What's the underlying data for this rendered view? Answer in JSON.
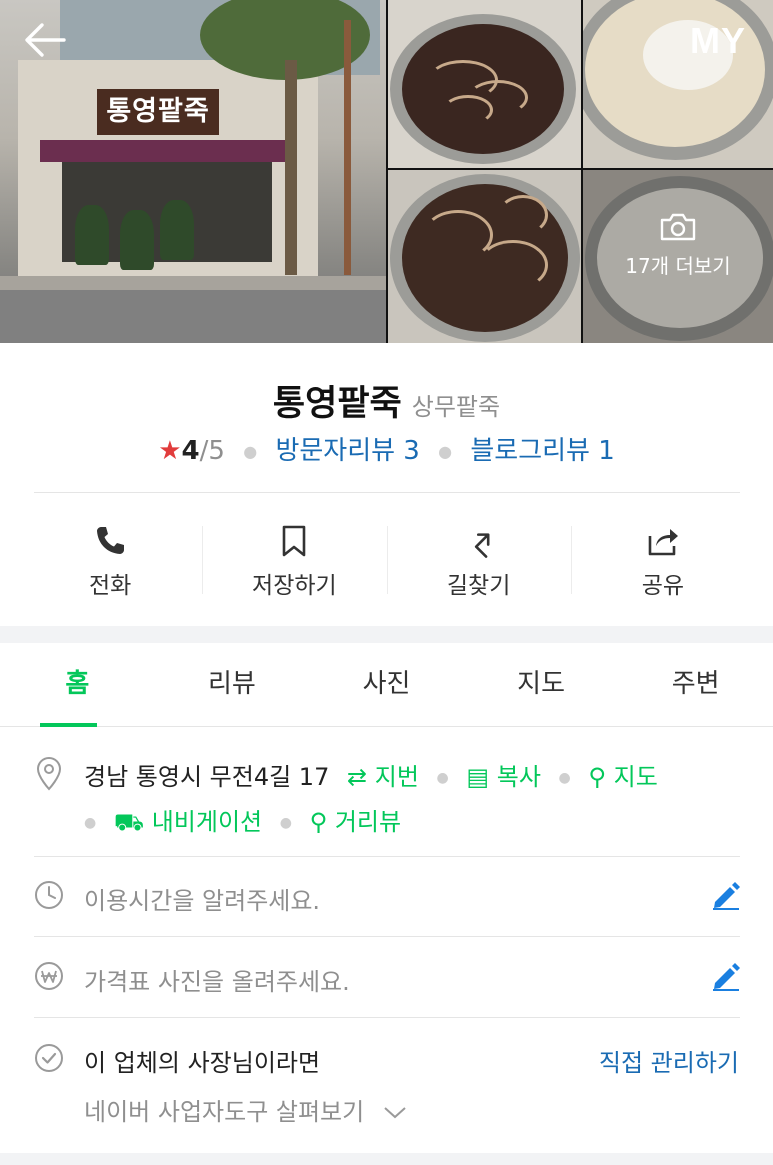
{
  "gallery": {
    "main_photo": {
      "signboard_text": "통영팥죽"
    },
    "more_photos_label": "17개 더보기",
    "my_label": "MY"
  },
  "place": {
    "name": "통영팥죽",
    "category": "상무팥죽",
    "rating": "4",
    "rating_max": "/5",
    "visitor_reviews": "방문자리뷰 3",
    "blog_reviews": "블로그리뷰 1"
  },
  "actions": [
    {
      "label": "전화",
      "icon": "phone-icon"
    },
    {
      "label": "저장하기",
      "icon": "bookmark-icon"
    },
    {
      "label": "길찾기",
      "icon": "directions-icon"
    },
    {
      "label": "공유",
      "icon": "share-icon"
    }
  ],
  "tabs": [
    {
      "label": "홈",
      "active": true
    },
    {
      "label": "리뷰",
      "active": false
    },
    {
      "label": "사진",
      "active": false
    },
    {
      "label": "지도",
      "active": false
    },
    {
      "label": "주변",
      "active": false
    }
  ],
  "info": {
    "address": "경남 통영시 무전4길 17",
    "address_links": [
      "지번",
      "복사",
      "지도"
    ],
    "address_links_2": [
      "내비게이션",
      "거리뷰"
    ],
    "hours_placeholder": "이용시간을 알려주세요.",
    "price_placeholder": "가격표 사진을 올려주세요.",
    "owner_text": "이 업체의 사장님이라면",
    "owner_link": "직접 관리하기",
    "owner_sub": "네이버 사업자도구 살펴보기"
  },
  "colors": {
    "accent_green": "#03c75a",
    "link_blue": "#1a6bb3",
    "star_red": "#e13c3c"
  }
}
